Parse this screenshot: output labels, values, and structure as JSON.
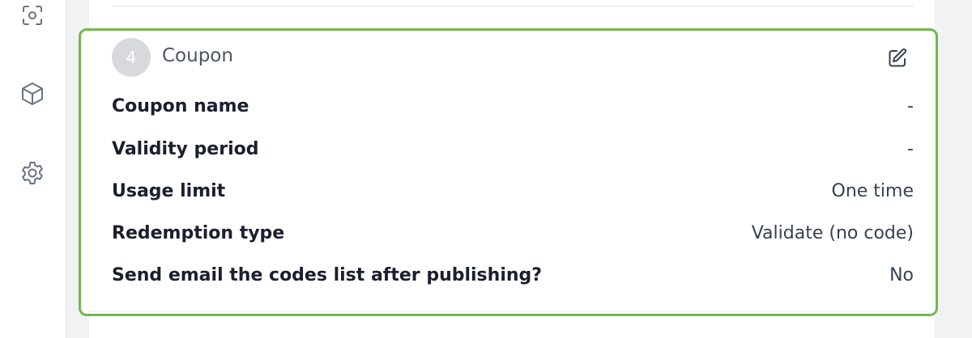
{
  "sidebar": {
    "icons": [
      {
        "name": "scan-icon"
      },
      {
        "name": "box-icon"
      },
      {
        "name": "gear-icon"
      }
    ]
  },
  "section": {
    "step_number": "4",
    "title": "Coupon",
    "edit_icon": "edit-icon",
    "rows": [
      {
        "label": "Coupon name",
        "value": "-"
      },
      {
        "label": "Validity period",
        "value": "-"
      },
      {
        "label": "Usage limit",
        "value": "One time"
      },
      {
        "label": "Redemption type",
        "value": "Validate (no code)"
      },
      {
        "label": "Send email the codes list after publishing?",
        "value": "No"
      }
    ],
    "border_color": "#72b84a"
  }
}
